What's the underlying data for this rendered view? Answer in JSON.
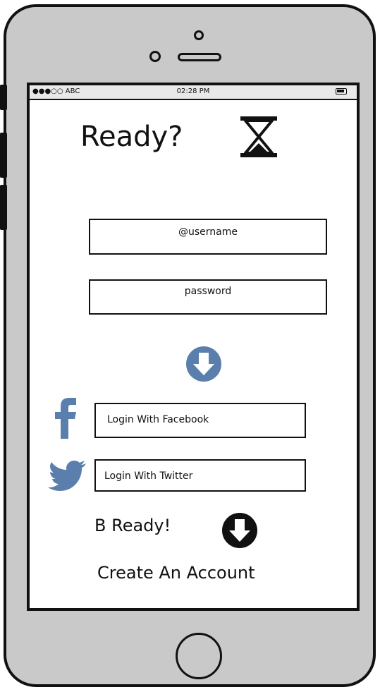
{
  "status_bar": {
    "carrier": "●●●○○ ABC",
    "time": "02:28 PM"
  },
  "header": {
    "title": "Ready?"
  },
  "form": {
    "username_placeholder": "@username",
    "password_placeholder": "password"
  },
  "social": {
    "facebook_label": "Login With Facebook",
    "twitter_label": "Login With Twitter"
  },
  "footer": {
    "b_ready": "B Ready!",
    "create_account": "Create An Account"
  },
  "colors": {
    "accent_blue": "#5b7fad",
    "outline": "#111111",
    "device": "#c9c9c9"
  }
}
